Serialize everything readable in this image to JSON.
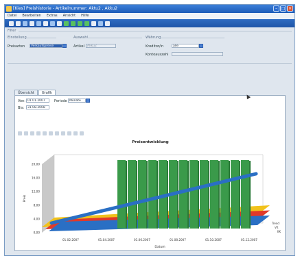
{
  "window": {
    "title": "[Kies] Preishistorie - Artikelnummer: Aktu2 , Akku2"
  },
  "menu": [
    "Datei",
    "Bearbeiten",
    "Extras",
    "Ansicht",
    "Hilfe"
  ],
  "filter": {
    "label": "Filter",
    "einstellung": {
      "label": "Einstellung",
      "preisarten_label": "Preisarten",
      "preisarten_value": "Verkaufspreise"
    },
    "auswahl": {
      "label": "Auswahl",
      "artikel_label": "Artikel",
      "artikel_value": "Akku2"
    },
    "waehrung": {
      "label": "Währung",
      "kreditor_label": "Kreditor/in",
      "kreditor_value": "alle",
      "kontoauszug_label": "Kontoauszahl",
      "kontoauszug_value": ""
    }
  },
  "tabs": [
    "Übersicht",
    "Grafik"
  ],
  "dates": {
    "von_label": "Von:",
    "von_value": "01.01.2007",
    "bis_label": "Bis:",
    "bis_value": "31.08.2008",
    "periode_label": "Periode",
    "periode_value": "Monate"
  },
  "chart_data": {
    "type": "bar",
    "title": "Preisentwicklung",
    "xlabel": "Datum",
    "ylabel": "Preis",
    "ylim": [
      0,
      20
    ],
    "y_ticks": [
      "0,00",
      "4,00",
      "8,00",
      "12,00",
      "16,00",
      "20,00"
    ],
    "categories": [
      "01.02.2007",
      "01.04.2007",
      "01.06.2007",
      "01.08.2007",
      "01.10.2007",
      "01.12.2007"
    ],
    "legend": [
      "Trend",
      "VK",
      "EK"
    ],
    "series_colors": [
      "#3a9a4a",
      "#2a6fc4",
      "#e0392a",
      "#f1c21b"
    ],
    "bars": [
      20,
      20,
      20,
      20,
      20,
      20,
      20,
      20,
      20,
      20,
      20,
      20,
      20
    ],
    "trend_line": {
      "start": 0,
      "end": 16
    }
  }
}
